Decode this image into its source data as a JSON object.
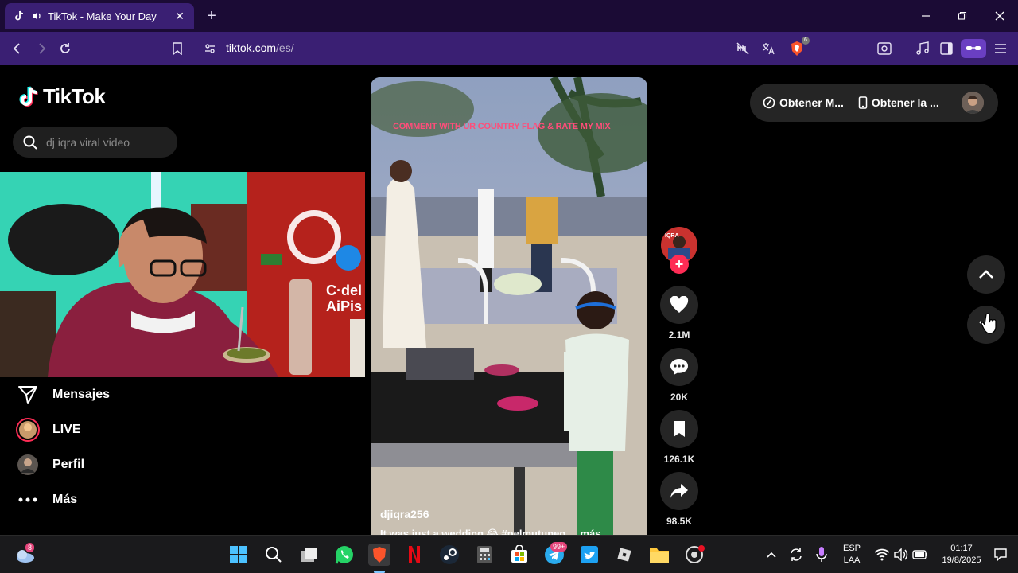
{
  "browser": {
    "tab_title": "TikTok - Make Your Day",
    "url_host": "tiktok.com",
    "url_path": "/es/",
    "shields_count": "6"
  },
  "sidebar": {
    "brand": "TikTok",
    "search_placeholder": "dj iqra viral video",
    "items": [
      {
        "label": "Mensajes",
        "icon": "send-icon"
      },
      {
        "label": "LIVE",
        "icon": "live-icon"
      },
      {
        "label": "Perfil",
        "icon": "profile-avatar"
      },
      {
        "label": "Más",
        "icon": "more-dots-icon"
      }
    ]
  },
  "webcam": {
    "sign_text": "C·del\nAiPis"
  },
  "video": {
    "overlay_text": "COMMENT WITH UR COUNTRY FLAG & RATE MY MIX",
    "author": "djiqra256",
    "caption": "It was just a wedding 😂 #pelmutuneg ... más",
    "likes": "2.1M",
    "comments": "20K",
    "saves": "126.1K",
    "shares": "98.5K"
  },
  "header_actions": {
    "get_coins": "Obtener M...",
    "get_app": "Obtener la ..."
  },
  "taskbar": {
    "weather_badge": "8",
    "telegram_badge": "99+",
    "lang_top": "ESP",
    "lang_bottom": "LAA",
    "time": "01:17",
    "date": "19/8/2025"
  }
}
